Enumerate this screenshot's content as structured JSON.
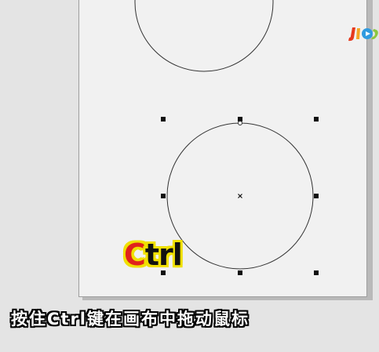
{
  "overlay": {
    "key_hint_first": "C",
    "key_hint_rest": "trl",
    "subtitle": "按住Ctrl键在画布中拖动鼠标"
  },
  "colors": {
    "workspace_bg": "#e4e4e4",
    "page_bg": "#f1f1f1",
    "key_hint_first_letter": "#e0231b",
    "key_hint_outline": "#f0e000",
    "subtitle_fill": "#ffffff",
    "subtitle_outline": "#000000"
  },
  "icons": {
    "watermark": "colored-logo-icon"
  }
}
